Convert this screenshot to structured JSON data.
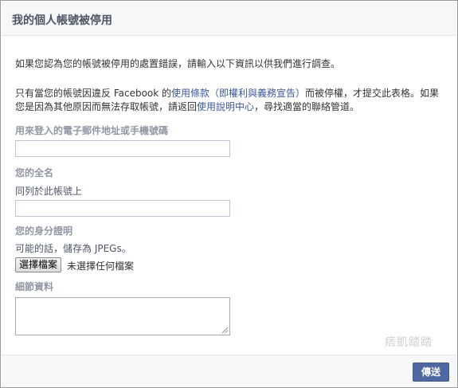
{
  "header": {
    "title": "我的個人帳號被停用"
  },
  "intro": {
    "line1": "如果您認為您的帳號被停用的處置錯誤，請輸入以下資訊以供我們進行調查。",
    "para2_before": "只有當您的帳號因違反 Facebook 的",
    "para2_link": "使用條款（即權利與義務宣告）",
    "para2_after": "而被停權，才提交此表格。如果",
    "para2_line2_before": "您是因為其他原因而無法存取帳號，請返回",
    "para2_line2_link": "使用說明中心",
    "para2_line2_after": "，尋找適當的聯絡管道。"
  },
  "fields": {
    "email_label": "用來登入的電子郵件地址或手機號碼",
    "name_label": "您的全名",
    "name_hint": "同列於此帳號上",
    "id_label": "您的身分證明",
    "id_hint": "可能的話，儲存為 JPEGs。",
    "file_button": "選擇檔案",
    "file_status": "未選擇任何檔案",
    "details_label": "細節資料"
  },
  "watermark": "痞凱踏踏",
  "footer": {
    "send_label": "傳送"
  }
}
